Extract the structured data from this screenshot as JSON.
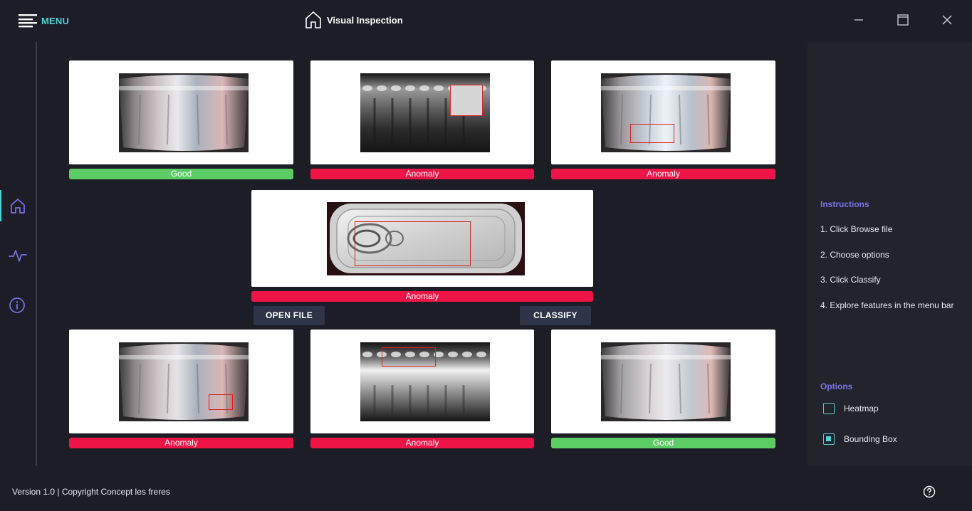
{
  "header": {
    "menu_label": "MENU",
    "title": "Visual Inspection",
    "icons": [
      "menu-icon",
      "home-icon",
      "minimize-icon",
      "maximize-icon",
      "close-icon"
    ]
  },
  "sidebar": {
    "items": [
      {
        "icon": "home-icon",
        "active": true
      },
      {
        "icon": "activity-icon",
        "active": false
      },
      {
        "icon": "info-icon",
        "active": false
      }
    ]
  },
  "gallery": {
    "top": [
      {
        "label": "Good",
        "status": "good"
      },
      {
        "label": "Anomaly",
        "status": "anomaly"
      },
      {
        "label": "Anomaly",
        "status": "anomaly"
      }
    ],
    "center": {
      "label": "Anomaly",
      "status": "anomaly"
    },
    "bottom": [
      {
        "label": "Anomaly",
        "status": "anomaly"
      },
      {
        "label": "Anomaly",
        "status": "anomaly"
      },
      {
        "label": "Good",
        "status": "good"
      }
    ]
  },
  "actions": {
    "open_file": "OPEN FILE",
    "classify": "CLASSIFY"
  },
  "instructions": {
    "heading": "Instructions",
    "steps": [
      "1. Click Browse file",
      "2. Choose options",
      "3. Click Classify",
      "4. Explore features in the menu bar"
    ]
  },
  "options": {
    "heading": "Options",
    "items": [
      {
        "label": "Heatmap",
        "checked": false
      },
      {
        "label": "Bounding Box",
        "checked": true
      }
    ]
  },
  "footer": {
    "version": "Version 1.0 | Copyright Concept les freres"
  },
  "colors": {
    "accent": "#4fd1d9",
    "heading": "#7b73e8",
    "good": "#5ccd65",
    "anomaly": "#ef1446",
    "button": "#2e3549",
    "background": "#1c1d26"
  }
}
